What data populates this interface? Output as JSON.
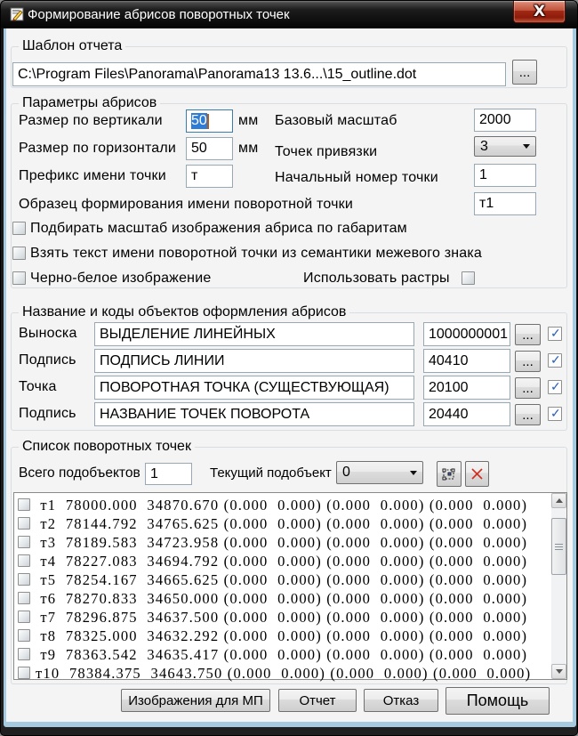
{
  "window": {
    "title": "Формирование абрисов поворотных точек"
  },
  "template_group": {
    "title": "Шаблон отчета",
    "path_value": "C:\\Program Files\\Panorama\\Panorama13 13.6...\\15_outline.dot",
    "browse_label": "..."
  },
  "params_group": {
    "title": "Параметры абрисов",
    "size_vertical_label": "Размер по вертикали",
    "size_vertical_value": "50",
    "mm_label_1": "мм",
    "base_scale_label": "Базовый масштаб",
    "base_scale_value": "2000",
    "size_horizontal_label": "Размер по горизонтали",
    "size_horizontal_value": "50",
    "mm_label_2": "мм",
    "anchor_points_label": "Точек привязки",
    "anchor_points_value": "3",
    "prefix_label": "Префикс имени точки",
    "prefix_value": "т",
    "start_number_label": "Начальный номер точки",
    "start_number_value": "1",
    "sample_label": "Образец формирования имени поворотной  точки",
    "sample_value": "т1",
    "checkbox_fit_scale": "Подбирать масштаб изображения абриса по габаритам",
    "checkbox_take_name": "Взять текст имени поворотной точки из семантики межевого знака",
    "checkbox_bw": "Черно-белое изображение",
    "checkbox_rasters": "Использовать  растры"
  },
  "objects_group": {
    "title": "Название и коды объектов оформления абрисов",
    "browse_label": "...",
    "rows": [
      {
        "label": "Выноска",
        "name": "ВЫДЕЛЕНИЕ ЛИНЕЙНЫХ",
        "code": "1000000001",
        "checked": true
      },
      {
        "label": "Подпись",
        "name": "ПОДПИСЬ ЛИНИИ",
        "code": "40410",
        "checked": true
      },
      {
        "label": "Точка",
        "name": "ПОВОРОТНАЯ ТОЧКА (СУЩЕСТВУЮЩАЯ)",
        "code": "20100",
        "checked": true
      },
      {
        "label": "Подпись",
        "name": "НАЗВАНИЕ ТОЧЕК ПОВОРОТА",
        "code": "20440",
        "checked": true
      }
    ]
  },
  "points_group": {
    "title": "Список поворотных точек",
    "total_label": "Всего подобъектов",
    "total_value": "1",
    "current_label": "Текущий подобъект",
    "current_value": "0",
    "rows": [
      " т1  78000.000  34870.670 (0.000  0.000) (0.000  0.000) (0.000  0.000)",
      " т2  78144.792  34765.625 (0.000  0.000) (0.000  0.000) (0.000  0.000)",
      " т3  78189.583  34723.958 (0.000  0.000) (0.000  0.000) (0.000  0.000)",
      " т4  78227.083  34694.792 (0.000  0.000) (0.000  0.000) (0.000  0.000)",
      " т5  78254.167  34665.625 (0.000  0.000) (0.000  0.000) (0.000  0.000)",
      " т6  78270.833  34650.000 (0.000  0.000) (0.000  0.000) (0.000  0.000)",
      " т7  78296.875  34637.500 (0.000  0.000) (0.000  0.000) (0.000  0.000)",
      " т8  78325.000  34632.292 (0.000  0.000) (0.000  0.000) (0.000  0.000)",
      " т9  78363.542  34635.417 (0.000  0.000) (0.000  0.000) (0.000  0.000)",
      "т10  78384.375  34643.750 (0.000  0.000) (0.000  0.000) (0.000  0.000)"
    ]
  },
  "footer": {
    "images_button": "Изображения для МП",
    "report_button": "Отчет",
    "cancel_button": "Отказ",
    "help_button": "Помощь"
  }
}
